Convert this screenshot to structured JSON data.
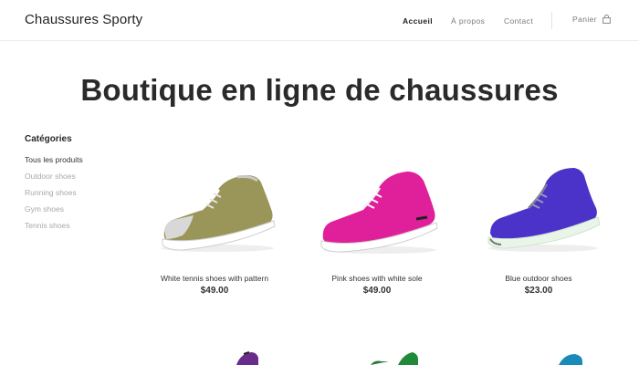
{
  "header": {
    "brand": "Chaussures Sporty",
    "nav": {
      "home": "Accueil",
      "about": "À propos",
      "contact": "Contact"
    },
    "cart_label": "Panier",
    "cart_icon": "shopping-bag-icon"
  },
  "main": {
    "title": "Boutique en ligne de chaussures"
  },
  "sidebar": {
    "heading": "Catégories",
    "items": [
      {
        "label": "Tous les produits",
        "active": true
      },
      {
        "label": "Outdoor shoes",
        "active": false
      },
      {
        "label": "Running shoes",
        "active": false
      },
      {
        "label": "Gym shoes",
        "active": false
      },
      {
        "label": "Tennis shoes",
        "active": false
      }
    ]
  },
  "products": [
    {
      "name": "White tennis shoes with pattern",
      "price": "$49.00",
      "color": "#9a9558"
    },
    {
      "name": "Pink shoes with white sole",
      "price": "$49.00",
      "color": "#e0209a"
    },
    {
      "name": "Blue outdoor shoes",
      "price": "$23.00",
      "color": "#4b33c9"
    }
  ],
  "colors": {
    "text": "#2b2b2b",
    "muted": "#a8a8a8",
    "border": "#ececec"
  }
}
